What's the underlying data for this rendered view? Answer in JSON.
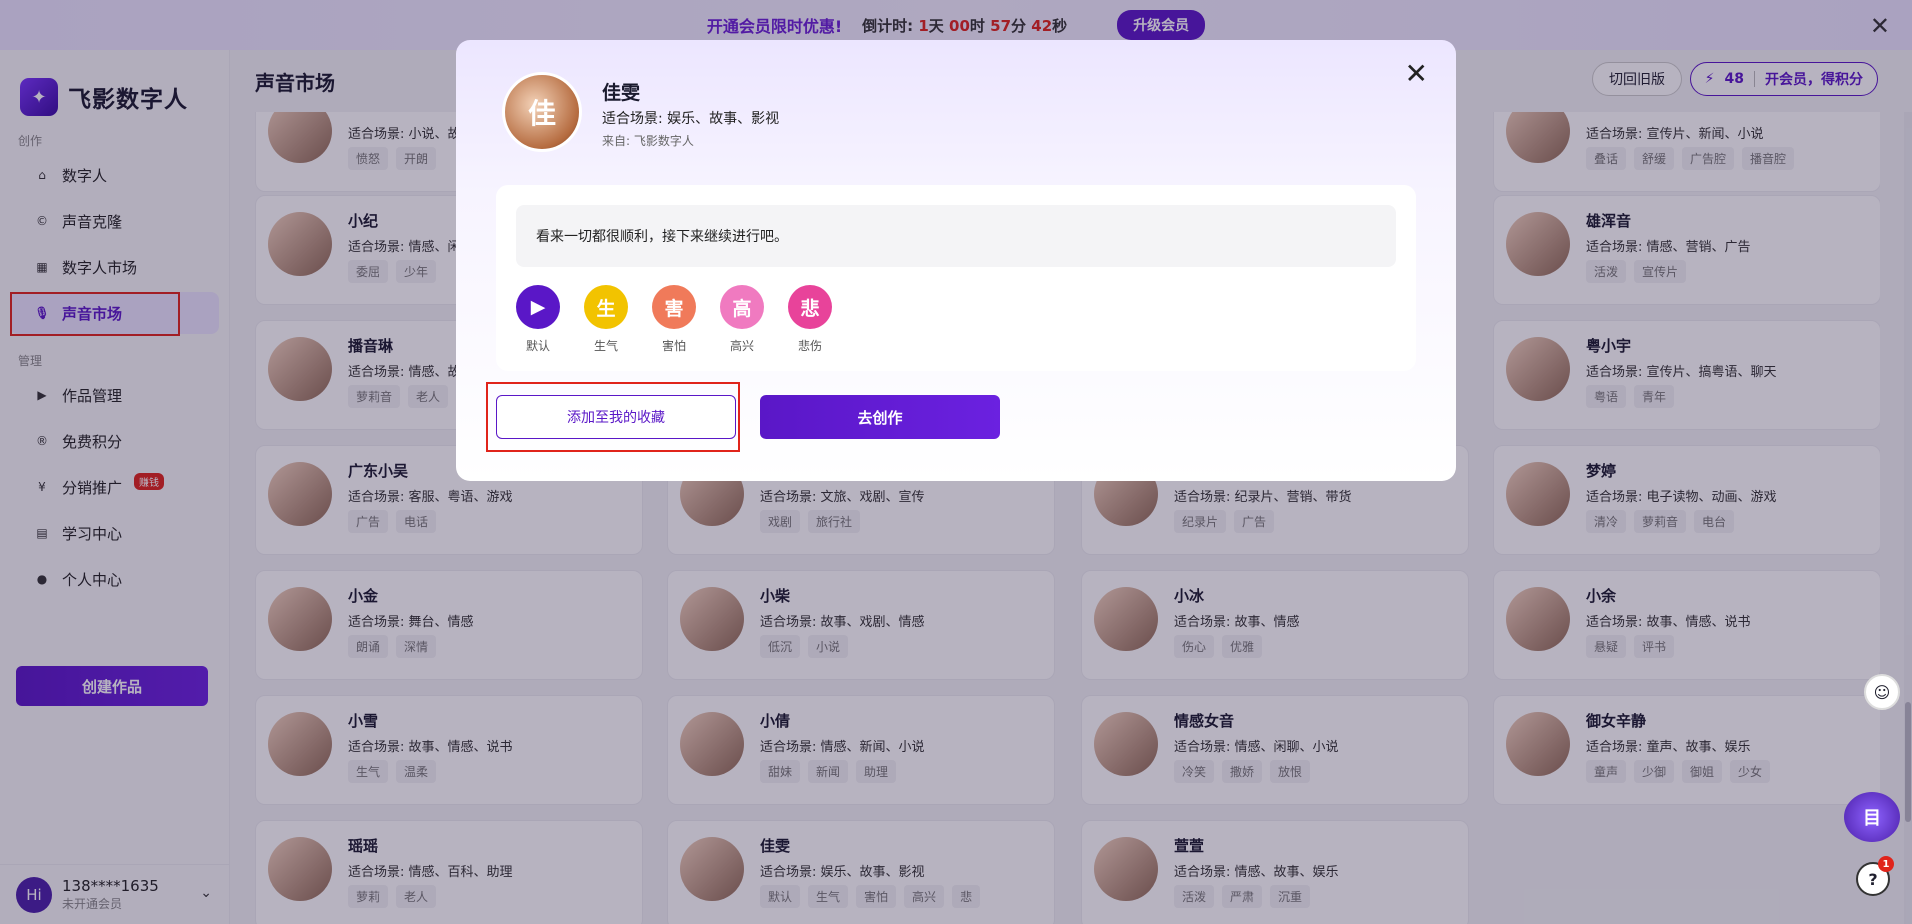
{
  "promo": {
    "headline": "开通会员限时优惠!",
    "countdown_label": "倒计时:",
    "days": "1",
    "days_unit": "天",
    "hours": "00",
    "hours_unit": "时",
    "minutes": "57",
    "minutes_unit": "分",
    "seconds": "42",
    "seconds_unit": "秒",
    "upgrade_button": "升级会员"
  },
  "sidebar": {
    "logo_text": "飞影数字人",
    "section_create": "创作",
    "create_items": [
      {
        "label": "数字人",
        "icon": "home-icon"
      },
      {
        "label": "声音克隆",
        "icon": "clone-icon"
      },
      {
        "label": "数字人市场",
        "icon": "grid-icon"
      },
      {
        "label": "声音市场",
        "icon": "microphone-icon"
      }
    ],
    "section_manage": "管理",
    "manage_items": [
      {
        "label": "作品管理",
        "icon": "video-icon"
      },
      {
        "label": "免费积分",
        "icon": "points-icon"
      },
      {
        "label": "分销推广",
        "icon": "share-icon",
        "badge": "赚钱"
      },
      {
        "label": "学习中心",
        "icon": "book-icon"
      },
      {
        "label": "个人中心",
        "icon": "user-icon"
      }
    ],
    "create_button": "创建作品",
    "user": {
      "avatar": "Hi",
      "phone": "138****1635",
      "membership": "未开通会员"
    }
  },
  "header": {
    "title": "声音市场",
    "switch_old": "切回旧版",
    "points": "48",
    "points_cta": "开会员，得积分"
  },
  "cards": [
    {
      "name": "",
      "scene": "适合场景: 小说、故事",
      "tags": [
        "愤怒",
        "开朗"
      ]
    },
    {
      "name": "",
      "scene": "适合场景: 宣传片、新闻、小说",
      "tags": [
        "叠话",
        "舒缓",
        "广告腔",
        "播音腔"
      ]
    },
    {
      "name": "小纪",
      "scene": "适合场景: 情感、闲聊",
      "tags": [
        "委屈",
        "少年"
      ]
    },
    {
      "name": "雄浑音",
      "scene": "适合场景: 情感、营销、广告",
      "tags": [
        "活泼",
        "宣传片"
      ]
    },
    {
      "name": "播音琳",
      "scene": "适合场景: 情感、故事",
      "tags": [
        "萝莉音",
        "老人"
      ]
    },
    {
      "name": "粤小宇",
      "scene": "适合场景: 宣传片、搞粤语、聊天",
      "tags": [
        "粤语",
        "青年"
      ]
    },
    {
      "name": "广东小吴",
      "scene": "适合场景: 客服、粤语、游戏",
      "tags": [
        "广告",
        "电话"
      ]
    },
    {
      "name": "",
      "scene": "适合场景: 文旅、戏剧、宣传",
      "tags": [
        "戏剧",
        "旅行社"
      ]
    },
    {
      "name": "",
      "scene": "适合场景: 纪录片、营销、带货",
      "tags": [
        "纪录片",
        "广告"
      ]
    },
    {
      "name": "梦婷",
      "scene": "适合场景: 电子读物、动画、游戏",
      "tags": [
        "清冷",
        "萝莉音",
        "电台"
      ]
    },
    {
      "name": "小金",
      "scene": "适合场景: 舞台、情感",
      "tags": [
        "朗诵",
        "深情"
      ]
    },
    {
      "name": "小柴",
      "scene": "适合场景: 故事、戏剧、情感",
      "tags": [
        "低沉",
        "小说"
      ]
    },
    {
      "name": "小冰",
      "scene": "适合场景: 故事、情感",
      "tags": [
        "伤心",
        "优雅"
      ]
    },
    {
      "name": "小余",
      "scene": "适合场景: 故事、情感、说书",
      "tags": [
        "悬疑",
        "评书"
      ]
    },
    {
      "name": "小雪",
      "scene": "适合场景: 故事、情感、说书",
      "tags": [
        "生气",
        "温柔"
      ]
    },
    {
      "name": "小倩",
      "scene": "适合场景: 情感、新闻、小说",
      "tags": [
        "甜妹",
        "新闻",
        "助理"
      ]
    },
    {
      "name": "情感女音",
      "scene": "适合场景: 情感、闲聊、小说",
      "tags": [
        "冷笑",
        "撒娇",
        "放恨"
      ]
    },
    {
      "name": "御女辛静",
      "scene": "适合场景: 童声、故事、娱乐",
      "tags": [
        "童声",
        "少御",
        "御姐",
        "少女"
      ]
    },
    {
      "name": "瑶瑶",
      "scene": "适合场景: 情感、百科、助理",
      "tags": [
        "萝莉",
        "老人"
      ]
    },
    {
      "name": "佳雯",
      "scene": "适合场景: 娱乐、故事、影视",
      "tags": [
        "默认",
        "生气",
        "害怕",
        "高兴",
        "悲"
      ]
    },
    {
      "name": "萱萱",
      "scene": "适合场景: 情感、故事、娱乐",
      "tags": [
        "活泼",
        "严肃",
        "沉重"
      ]
    }
  ],
  "modal": {
    "name": "佳雯",
    "scene": "适合场景: 娱乐、故事、影视",
    "source": "来自: 飞影数字人",
    "sample_text": "看来一切都很顺利，接下来继续进行吧。",
    "emotions": [
      {
        "char": "",
        "label": "默认",
        "color": "#5a17c7"
      },
      {
        "char": "生",
        "label": "生气",
        "color": "#f2c300"
      },
      {
        "char": "害",
        "label": "害怕",
        "color": "#f07a5a"
      },
      {
        "char": "高",
        "label": "高兴",
        "color": "#f07ac0"
      },
      {
        "char": "悲",
        "label": "悲伤",
        "color": "#e8439a"
      }
    ],
    "favorite_button": "添加至我的收藏",
    "create_button": "去创作"
  },
  "float": {
    "help_badge": "1"
  },
  "colors": {
    "brand": "#5a17c7",
    "highlight": "#e0241b"
  }
}
